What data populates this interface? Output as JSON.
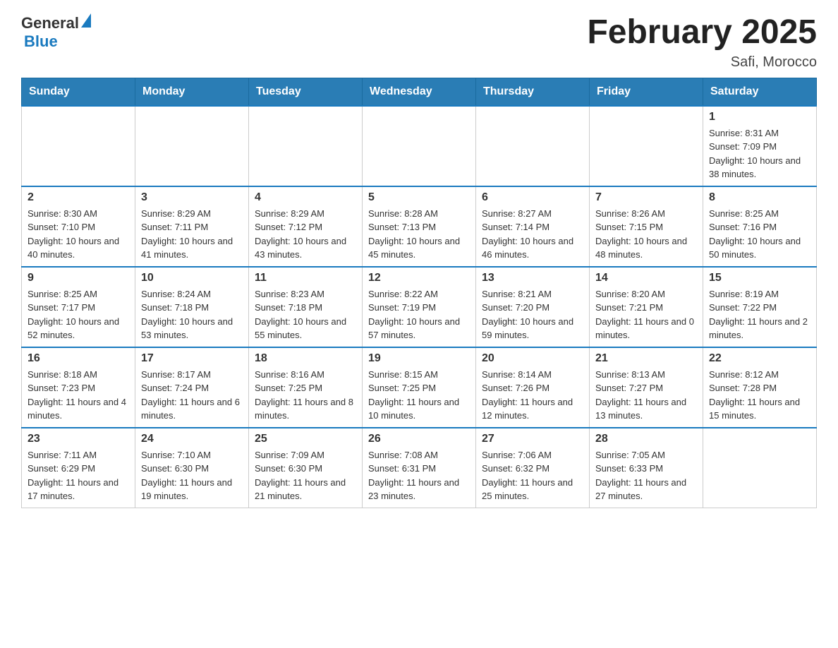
{
  "header": {
    "logo_general": "General",
    "logo_blue": "Blue",
    "title": "February 2025",
    "location": "Safi, Morocco"
  },
  "calendar": {
    "weekdays": [
      "Sunday",
      "Monday",
      "Tuesday",
      "Wednesday",
      "Thursday",
      "Friday",
      "Saturday"
    ],
    "weeks": [
      [
        {
          "day": "",
          "sunrise": "",
          "sunset": "",
          "daylight": ""
        },
        {
          "day": "",
          "sunrise": "",
          "sunset": "",
          "daylight": ""
        },
        {
          "day": "",
          "sunrise": "",
          "sunset": "",
          "daylight": ""
        },
        {
          "day": "",
          "sunrise": "",
          "sunset": "",
          "daylight": ""
        },
        {
          "day": "",
          "sunrise": "",
          "sunset": "",
          "daylight": ""
        },
        {
          "day": "",
          "sunrise": "",
          "sunset": "",
          "daylight": ""
        },
        {
          "day": "1",
          "sunrise": "Sunrise: 8:31 AM",
          "sunset": "Sunset: 7:09 PM",
          "daylight": "Daylight: 10 hours and 38 minutes."
        }
      ],
      [
        {
          "day": "2",
          "sunrise": "Sunrise: 8:30 AM",
          "sunset": "Sunset: 7:10 PM",
          "daylight": "Daylight: 10 hours and 40 minutes."
        },
        {
          "day": "3",
          "sunrise": "Sunrise: 8:29 AM",
          "sunset": "Sunset: 7:11 PM",
          "daylight": "Daylight: 10 hours and 41 minutes."
        },
        {
          "day": "4",
          "sunrise": "Sunrise: 8:29 AM",
          "sunset": "Sunset: 7:12 PM",
          "daylight": "Daylight: 10 hours and 43 minutes."
        },
        {
          "day": "5",
          "sunrise": "Sunrise: 8:28 AM",
          "sunset": "Sunset: 7:13 PM",
          "daylight": "Daylight: 10 hours and 45 minutes."
        },
        {
          "day": "6",
          "sunrise": "Sunrise: 8:27 AM",
          "sunset": "Sunset: 7:14 PM",
          "daylight": "Daylight: 10 hours and 46 minutes."
        },
        {
          "day": "7",
          "sunrise": "Sunrise: 8:26 AM",
          "sunset": "Sunset: 7:15 PM",
          "daylight": "Daylight: 10 hours and 48 minutes."
        },
        {
          "day": "8",
          "sunrise": "Sunrise: 8:25 AM",
          "sunset": "Sunset: 7:16 PM",
          "daylight": "Daylight: 10 hours and 50 minutes."
        }
      ],
      [
        {
          "day": "9",
          "sunrise": "Sunrise: 8:25 AM",
          "sunset": "Sunset: 7:17 PM",
          "daylight": "Daylight: 10 hours and 52 minutes."
        },
        {
          "day": "10",
          "sunrise": "Sunrise: 8:24 AM",
          "sunset": "Sunset: 7:18 PM",
          "daylight": "Daylight: 10 hours and 53 minutes."
        },
        {
          "day": "11",
          "sunrise": "Sunrise: 8:23 AM",
          "sunset": "Sunset: 7:18 PM",
          "daylight": "Daylight: 10 hours and 55 minutes."
        },
        {
          "day": "12",
          "sunrise": "Sunrise: 8:22 AM",
          "sunset": "Sunset: 7:19 PM",
          "daylight": "Daylight: 10 hours and 57 minutes."
        },
        {
          "day": "13",
          "sunrise": "Sunrise: 8:21 AM",
          "sunset": "Sunset: 7:20 PM",
          "daylight": "Daylight: 10 hours and 59 minutes."
        },
        {
          "day": "14",
          "sunrise": "Sunrise: 8:20 AM",
          "sunset": "Sunset: 7:21 PM",
          "daylight": "Daylight: 11 hours and 0 minutes."
        },
        {
          "day": "15",
          "sunrise": "Sunrise: 8:19 AM",
          "sunset": "Sunset: 7:22 PM",
          "daylight": "Daylight: 11 hours and 2 minutes."
        }
      ],
      [
        {
          "day": "16",
          "sunrise": "Sunrise: 8:18 AM",
          "sunset": "Sunset: 7:23 PM",
          "daylight": "Daylight: 11 hours and 4 minutes."
        },
        {
          "day": "17",
          "sunrise": "Sunrise: 8:17 AM",
          "sunset": "Sunset: 7:24 PM",
          "daylight": "Daylight: 11 hours and 6 minutes."
        },
        {
          "day": "18",
          "sunrise": "Sunrise: 8:16 AM",
          "sunset": "Sunset: 7:25 PM",
          "daylight": "Daylight: 11 hours and 8 minutes."
        },
        {
          "day": "19",
          "sunrise": "Sunrise: 8:15 AM",
          "sunset": "Sunset: 7:25 PM",
          "daylight": "Daylight: 11 hours and 10 minutes."
        },
        {
          "day": "20",
          "sunrise": "Sunrise: 8:14 AM",
          "sunset": "Sunset: 7:26 PM",
          "daylight": "Daylight: 11 hours and 12 minutes."
        },
        {
          "day": "21",
          "sunrise": "Sunrise: 8:13 AM",
          "sunset": "Sunset: 7:27 PM",
          "daylight": "Daylight: 11 hours and 13 minutes."
        },
        {
          "day": "22",
          "sunrise": "Sunrise: 8:12 AM",
          "sunset": "Sunset: 7:28 PM",
          "daylight": "Daylight: 11 hours and 15 minutes."
        }
      ],
      [
        {
          "day": "23",
          "sunrise": "Sunrise: 7:11 AM",
          "sunset": "Sunset: 6:29 PM",
          "daylight": "Daylight: 11 hours and 17 minutes."
        },
        {
          "day": "24",
          "sunrise": "Sunrise: 7:10 AM",
          "sunset": "Sunset: 6:30 PM",
          "daylight": "Daylight: 11 hours and 19 minutes."
        },
        {
          "day": "25",
          "sunrise": "Sunrise: 7:09 AM",
          "sunset": "Sunset: 6:30 PM",
          "daylight": "Daylight: 11 hours and 21 minutes."
        },
        {
          "day": "26",
          "sunrise": "Sunrise: 7:08 AM",
          "sunset": "Sunset: 6:31 PM",
          "daylight": "Daylight: 11 hours and 23 minutes."
        },
        {
          "day": "27",
          "sunrise": "Sunrise: 7:06 AM",
          "sunset": "Sunset: 6:32 PM",
          "daylight": "Daylight: 11 hours and 25 minutes."
        },
        {
          "day": "28",
          "sunrise": "Sunrise: 7:05 AM",
          "sunset": "Sunset: 6:33 PM",
          "daylight": "Daylight: 11 hours and 27 minutes."
        },
        {
          "day": "",
          "sunrise": "",
          "sunset": "",
          "daylight": ""
        }
      ]
    ]
  }
}
